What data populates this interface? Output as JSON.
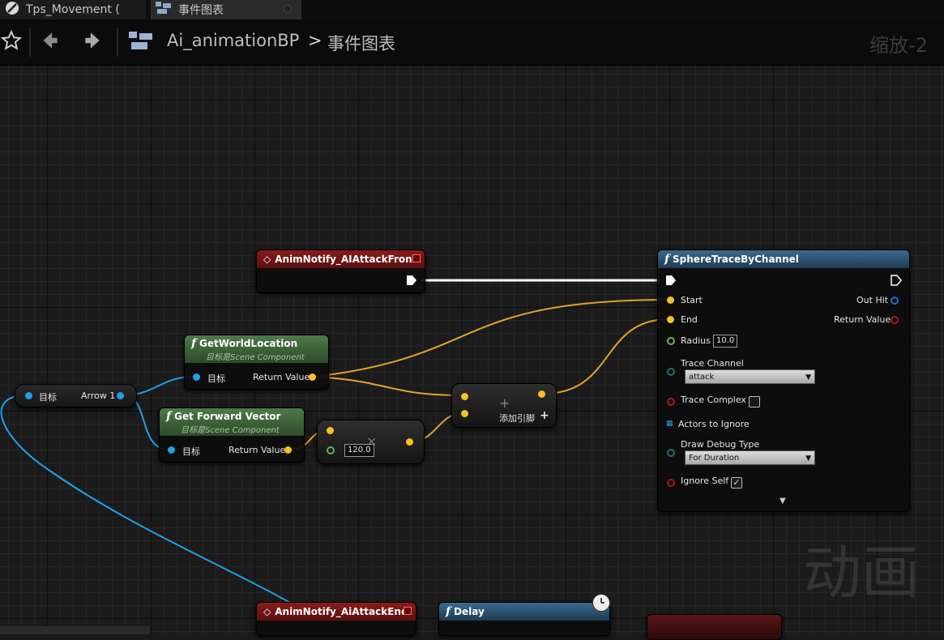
{
  "tabs": [
    {
      "label": "Tps_Movement ("
    },
    {
      "label": "事件图表"
    }
  ],
  "breadcrumb": {
    "blueprint": "Ai_animationBP",
    "separator": ">",
    "graph": "事件图表"
  },
  "zoom_label": "缩放-2",
  "watermark": "动画",
  "nodes": {
    "anim_notify_front": {
      "title": "AnimNotify_AIAttackFront"
    },
    "anim_notify_end": {
      "title": "AnimNotify_AiAttackEnd"
    },
    "delay": {
      "title": "Delay"
    },
    "get_world_location": {
      "title": "GetWorldLocation",
      "subtitle_prefix": "目标是",
      "subtitle_class": "Scene Component",
      "target_label": "目标",
      "return_label": "Return Value"
    },
    "get_forward_vector": {
      "title": "Get Forward Vector",
      "subtitle_prefix": "目标是",
      "subtitle_class": "Scene Component",
      "target_label": "目标",
      "return_label": "Return Value"
    },
    "arrow_var": {
      "target_label": "目标",
      "var_name": "Arrow 1"
    },
    "multiply": {
      "value": "120.0",
      "op": "×"
    },
    "add": {
      "op": "+",
      "add_pin_label": "添加引脚",
      "add_pin_plus": "+"
    },
    "sphere_trace": {
      "title": "SphereTraceByChannel",
      "start_label": "Start",
      "end_label": "End",
      "radius_label": "Radius",
      "radius_value": "10.0",
      "trace_channel_label": "Trace Channel",
      "trace_channel_value": "attack",
      "trace_complex_label": "Trace Complex",
      "actors_to_ignore_label": "Actors to Ignore",
      "draw_debug_label": "Draw Debug Type",
      "draw_debug_value": "For Duration",
      "ignore_self_label": "Ignore Self",
      "ignore_self_checked": true,
      "out_hit_label": "Out Hit",
      "return_label": "Return Value"
    }
  },
  "colors": {
    "exec": "#ffffff",
    "vector_pin": "#f6c026",
    "object_pin": "#1ea1e6",
    "event_header": "#8a1c1c",
    "function_header": "#3c6a8e",
    "pure_header": "#4f7a4a"
  }
}
